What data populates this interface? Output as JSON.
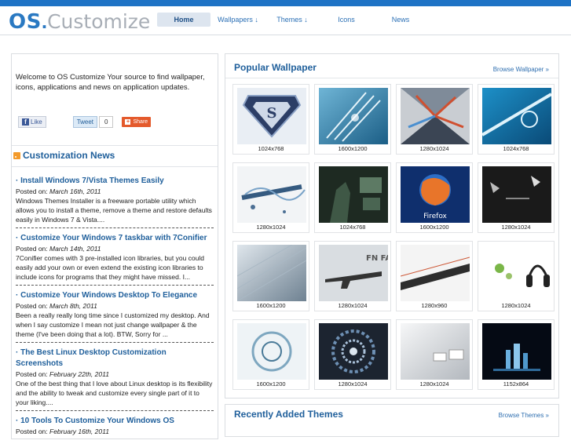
{
  "header": {
    "logo_os": "OS",
    "logo_dot": ".",
    "logo_customize": "Customize",
    "nav": [
      {
        "label": "Home",
        "active": true
      },
      {
        "label": "Wallpapers ↓"
      },
      {
        "label": "Themes ↓"
      },
      {
        "label": "Icons"
      },
      {
        "label": "News"
      }
    ]
  },
  "sidebar": {
    "welcome": "Welcome to OS Customize Your source to find wallpaper, icons, applications and news on application updates.",
    "like_label": "Like",
    "tweet_label": "Tweet",
    "tweet_count": "0",
    "share_label": "Share",
    "news_heading": "Customization News",
    "news": [
      {
        "title": "· Install Windows 7/Vista Themes Easily",
        "posted_prefix": "Posted on: ",
        "date": "March 16th, 2011",
        "summary": "Windows Themes Installer is a freeware portable utility which allows you to install a theme, remove a theme and restore defaults easily in Windows 7 & Vista...."
      },
      {
        "title": "· Customize Your Windows 7 taskbar with 7Conifier",
        "posted_prefix": "Posted on: ",
        "date": "March 14th, 2011",
        "summary": "7Conifier comes with 3 pre-installed icon libraries, but you could easily add your own or even extend the existing icon libraries to include icons for programs that they might have missed. I..."
      },
      {
        "title": "· Customize Your Windows Desktop To Elegance",
        "posted_prefix": "Posted on: ",
        "date": "March 8th, 2011",
        "summary": "Been a really really long time since I customized my desktop. And when I say customize I mean not just change wallpaper & the theme (I've been doing that a lot). BTW, Sorry for ..."
      },
      {
        "title": "· The Best Linux Desktop Customization Screenshots",
        "posted_prefix": "Posted on: ",
        "date": "February 22th, 2011",
        "summary": "One of the best thing that I love about Linux desktop is its flexibility and the ability to tweak and customize every single part of it to your liking...."
      },
      {
        "title": "· 10 Tools To Customize Your Windows OS",
        "posted_prefix": "Posted on: ",
        "date": "February 16th, 2011",
        "summary": ""
      }
    ]
  },
  "main": {
    "popular_title": "Popular Wallpaper",
    "browse_wallpaper": "Browse Wallpaper »",
    "wallpapers": [
      {
        "res": "1024x768"
      },
      {
        "res": "1600x1200"
      },
      {
        "res": "1280x1024"
      },
      {
        "res": "1024x768"
      },
      {
        "res": "1280x1024"
      },
      {
        "res": "1024x768"
      },
      {
        "res": "1600x1200"
      },
      {
        "res": "1280x1024"
      },
      {
        "res": "1600x1200"
      },
      {
        "res": "1280x1024"
      },
      {
        "res": "1280x960"
      },
      {
        "res": "1280x1024"
      },
      {
        "res": "1600x1200"
      },
      {
        "res": "1280x1024"
      },
      {
        "res": "1280x1024"
      },
      {
        "res": "1152x864"
      }
    ],
    "thumb_text_1": "Firefox",
    "thumb_text_2": "FN FAL",
    "themes_title": "Recently Added Themes",
    "browse_themes": "Browse Themes »"
  },
  "colors": {
    "accent_blue": "#1e73c5",
    "heading_blue": "#1f5f9b",
    "share_orange": "#e45a2c"
  }
}
